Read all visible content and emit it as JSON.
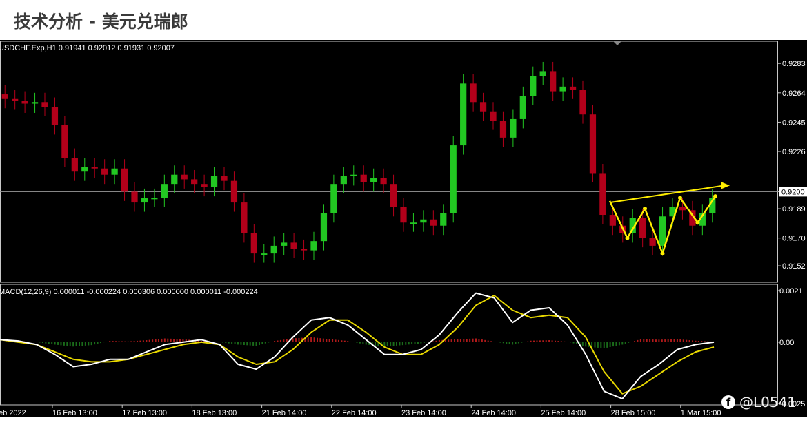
{
  "page": {
    "title": "技术分析 - 美元兑瑞郎"
  },
  "watermark": {
    "icon": "facebook-icon",
    "handle": "@L0541"
  },
  "chart_data": [
    {
      "type": "candlestick",
      "symbol_header": "USDCHF.Exp,H1  0.91941 0.92012 0.91931 0.92007",
      "open": 0.91941,
      "high": 0.92012,
      "low": 0.91931,
      "close": 0.92007,
      "current_price_label": "0.9200",
      "y_ticks": [
        "0.9283",
        "0.9264",
        "0.9245",
        "0.9226",
        "0.9200",
        "0.9189",
        "0.9170",
        "0.9152"
      ],
      "ylim": [
        0.9144,
        0.9292
      ],
      "close_series": [
        0.926,
        0.9259,
        0.9257,
        0.9258,
        0.9255,
        0.9243,
        0.9222,
        0.9213,
        0.9216,
        0.9215,
        0.9211,
        0.9215,
        0.92,
        0.9193,
        0.9196,
        0.9196,
        0.9205,
        0.9211,
        0.9208,
        0.9205,
        0.9203,
        0.921,
        0.9207,
        0.9193,
        0.9173,
        0.916,
        0.916,
        0.9165,
        0.9167,
        0.9163,
        0.9162,
        0.9168,
        0.9186,
        0.9205,
        0.921,
        0.9211,
        0.9206,
        0.9209,
        0.9205,
        0.919,
        0.918,
        0.918,
        0.9182,
        0.9178,
        0.9186,
        0.923,
        0.927,
        0.9258,
        0.9252,
        0.9246,
        0.9235,
        0.9247,
        0.9262,
        0.9275,
        0.9278,
        0.9265,
        0.9268,
        0.9266,
        0.925,
        0.9212,
        0.9185,
        0.9178,
        0.9173,
        0.9183,
        0.917,
        0.9165,
        0.9184,
        0.919,
        0.9188,
        0.9178,
        0.9186,
        0.9196
      ],
      "pattern_points": [
        0.9194,
        0.917,
        0.9189,
        0.916,
        0.9196,
        0.918,
        0.9197
      ],
      "trendline": {
        "from": 0.9193,
        "to": 0.9204
      },
      "colors": {
        "bull": "#22c722",
        "bear": "#b3001a",
        "pattern": "#ffee00",
        "background": "#000000",
        "grid_text": "#ffffff"
      }
    },
    {
      "type": "macd",
      "header": "MACD(12,26,9) 0.000011 -0.000224 0.000306 0.000000 0.000011 -0.000224",
      "y_ticks": [
        "0.0021",
        "0.00",
        "-0.0025"
      ],
      "ylim": [
        -0.0025,
        0.0021
      ],
      "macd_line": [
        0.0001,
        5e-05,
        -0.0001,
        -0.0005,
        -0.001,
        -0.0009,
        -0.0007,
        -0.0007,
        -0.0004,
        -0.0001,
        0.0,
        0.0001,
        -0.0001,
        -0.0009,
        -0.0011,
        -0.0006,
        0.0002,
        0.0009,
        0.001,
        0.0007,
        0.0001,
        -0.0005,
        -0.0005,
        -0.0003,
        0.0003,
        0.0012,
        0.002,
        0.0018,
        0.0008,
        0.0013,
        0.0014,
        0.0007,
        -0.0005,
        -0.002,
        -0.0023,
        -0.0014,
        -0.0009,
        -0.0003,
        -0.0001,
        0.0
      ],
      "signal_line": [
        0.0001,
        0.0,
        -0.0001,
        -0.0004,
        -0.0007,
        -0.0008,
        -0.0008,
        -0.0007,
        -0.0005,
        -0.0003,
        -0.0001,
        0.0,
        -0.0001,
        -0.0006,
        -0.0009,
        -0.0008,
        -0.0003,
        0.0004,
        0.0009,
        0.0009,
        0.0004,
        -0.0002,
        -0.0005,
        -0.0005,
        -0.0001,
        0.0006,
        0.0015,
        0.0019,
        0.0013,
        0.001,
        0.0011,
        0.001,
        0.0002,
        -0.0012,
        -0.0021,
        -0.0018,
        -0.0013,
        -0.0008,
        -0.0004,
        -0.0002
      ],
      "histogram": [
        2e-05,
        5e-05,
        0.0,
        -0.0001,
        -0.00018,
        -0.00012,
        5e-05,
        3e-05,
        8e-05,
        0.00015,
        0.00012,
        5e-05,
        0.0,
        -0.0001,
        -0.00015,
        5e-05,
        0.00015,
        0.0002,
        0.00012,
        5e-05,
        -0.0001,
        -0.00018,
        -0.00012,
        -5e-05,
        8e-05,
        0.00012,
        0.00015,
        2e-05,
        -0.0001,
        6e-05,
        8e-05,
        2e-05,
        -0.00018,
        -0.00025,
        -0.0001,
        0.00012,
        0.0001,
        0.00012,
        6e-05,
        2e-05
      ],
      "colors": {
        "macd": "#ffffff",
        "signal": "#e8d800",
        "hist_pos": "#b01a1a",
        "hist_neg": "#1a6b1a"
      }
    }
  ],
  "x_axis": {
    "labels": [
      "eb 2022",
      "16 Feb 13:00",
      "17 Feb 13:00",
      "18 Feb 13:00",
      "21 Feb 14:00",
      "22 Feb 14:00",
      "23 Feb 14:00",
      "24 Feb 14:00",
      "25 Feb 14:00",
      "28 Feb 15:00",
      "1 Mar 15:00"
    ]
  }
}
